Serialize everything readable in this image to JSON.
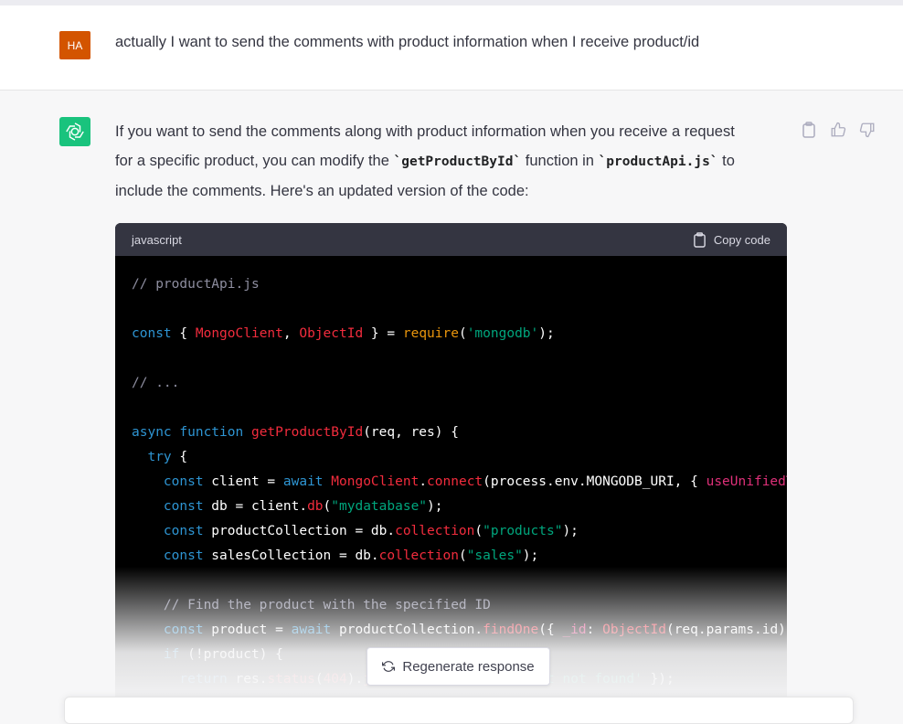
{
  "user_message": {
    "avatar_initials": "HA",
    "text": "actually I want to send the comments with product information when I receive product/id"
  },
  "assistant_message": {
    "intro_part1": "If you want to send the comments along with product information when you receive a request for a specific product, you can modify the ",
    "inline_code_1": "`getProductById`",
    "intro_part2": " function in ",
    "inline_code_2": "`productApi.js`",
    "intro_part3": " to include the comments. Here's an updated version of the code:"
  },
  "code_block": {
    "language": "javascript",
    "copy_label": "Copy code"
  },
  "actions": [
    "clipboard-icon",
    "thumbs-up-icon",
    "thumbs-down-icon"
  ],
  "regenerate_label": "Regenerate response",
  "colors": {
    "user_avatar": "#d35400",
    "bot_avatar": "#19c37d",
    "keyword": "#2e95d3",
    "function": "#f22c3d",
    "string": "#00a67d",
    "comment": "#8e8ea0"
  }
}
